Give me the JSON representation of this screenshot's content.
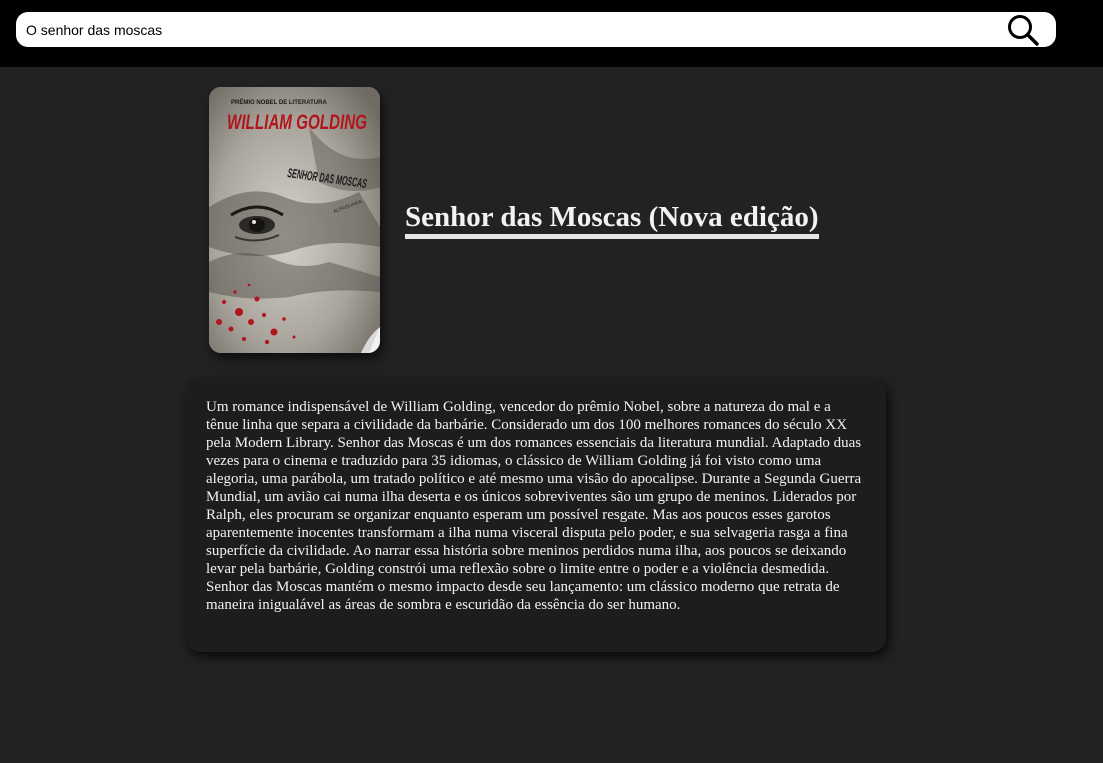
{
  "search": {
    "value": "O senhor das moscas"
  },
  "book": {
    "title": "Senhor das Moscas (Nova edição)",
    "cover": {
      "series": "PRÊMIO NOBEL DE LITERATURA",
      "author": "WILLIAM GOLDING",
      "title": "SENHOR DAS MOSCAS",
      "publisher": "ALFAGUARA"
    },
    "description": "Um romance indispensável de William Golding, vencedor do prêmio Nobel, sobre a natureza do mal e a tênue linha que separa a civilidade da barbárie. Considerado um dos 100 melhores romances do século XX pela Modern Library. Senhor das Moscas é um dos romances essenciais da literatura mundial. Adaptado duas vezes para o cinema e traduzido para 35 idiomas, o clássico de William Golding já foi visto como uma alegoria, uma parábola, um tratado político e até mesmo uma visão do apocalipse. Durante a Segunda Guerra Mundial, um avião cai numa ilha deserta e os únicos sobreviventes são um grupo de meninos. Liderados por Ralph, eles procuram se organizar enquanto esperam um possível resgate. Mas aos poucos esses garotos aparentemente inocentes transformam a ilha numa visceral disputa pelo poder, e sua selvageria rasga a fina superfície da civilidade. Ao narrar essa história sobre meninos perdidos numa ilha, aos poucos se deixando levar pela barbárie, Golding constrói uma reflexão sobre o limite entre o poder e a violência desmedida. Senhor das Moscas mantém o mesmo impacto desde seu lançamento: um clássico moderno que retrata de maneira inigualável as áreas de sombra e escuridão da essência do ser humano."
  },
  "icons": {
    "search": "search-icon"
  },
  "colors": {
    "topbar": "#000000",
    "page_background": "#222222",
    "card_background": "#1d1d1d",
    "text": "#f2f2f2",
    "cover_red": "#b3151c"
  }
}
